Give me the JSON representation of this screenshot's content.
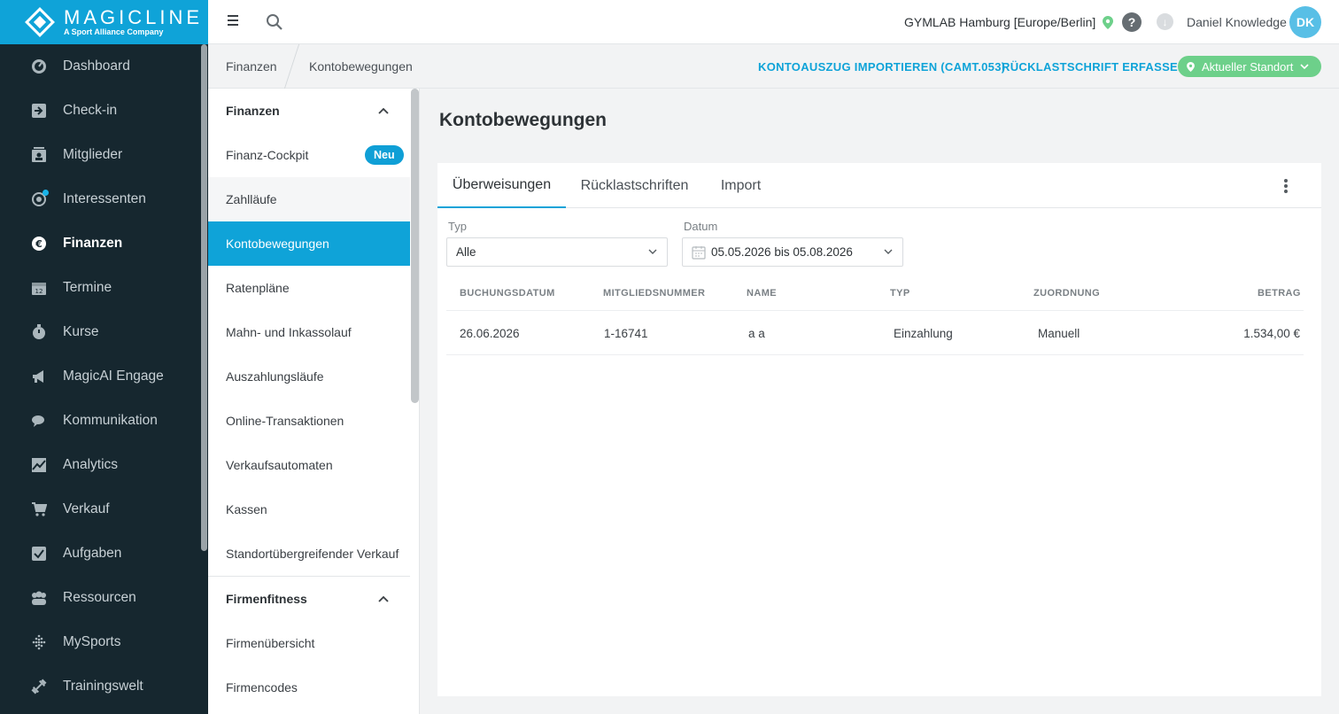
{
  "brand": {
    "name": "MAGICLINE",
    "tagline": "A Sport Alliance Company"
  },
  "left_nav": {
    "items": [
      {
        "label": "Dashboard",
        "icon": "dashboard-icon"
      },
      {
        "label": "Check-in",
        "icon": "checkin-icon"
      },
      {
        "label": "Mitglieder",
        "icon": "members-icon"
      },
      {
        "label": "Interessenten",
        "icon": "prospects-icon"
      },
      {
        "label": "Finanzen",
        "icon": "euro-icon"
      },
      {
        "label": "Termine",
        "icon": "calendar-icon"
      },
      {
        "label": "Kurse",
        "icon": "timer-icon"
      },
      {
        "label": "MagicAI Engage",
        "icon": "megaphone-icon"
      },
      {
        "label": "Kommunikation",
        "icon": "chat-icon"
      },
      {
        "label": "Analytics",
        "icon": "chart-icon"
      },
      {
        "label": "Verkauf",
        "icon": "cart-icon"
      },
      {
        "label": "Aufgaben",
        "icon": "checkbox-icon"
      },
      {
        "label": "Ressourcen",
        "icon": "people-icon"
      },
      {
        "label": "MySports",
        "icon": "dots-grid-icon"
      },
      {
        "label": "Trainingswelt",
        "icon": "dumbbell-icon"
      }
    ],
    "active": "Finanzen"
  },
  "topbar": {
    "location": "GYMLAB Hamburg [Europe/Berlin]",
    "user_name": "Daniel Knowledge",
    "avatar_initials": "DK"
  },
  "breadcrumb": {
    "parent": "Finanzen",
    "current": "Kontobewegungen"
  },
  "actions": {
    "import_label": "KONTOAUSZUG IMPORTIEREN (CAMT.053)",
    "chargeback_label": "RÜCKLASTSCHRIFT ERFASSEN",
    "location_button": "Aktueller Standort"
  },
  "sub_nav": {
    "group1": "Finanzen",
    "items": [
      {
        "label": "Finanz-Cockpit"
      },
      {
        "label": "Zahlläufe"
      },
      {
        "label": "Kontobewegungen"
      },
      {
        "label": "Ratenpläne"
      },
      {
        "label": "Mahn- und Inkassolauf"
      },
      {
        "label": "Auszahlungsläufe"
      },
      {
        "label": "Online-Transaktionen"
      },
      {
        "label": "Verkaufsautomaten"
      },
      {
        "label": "Kassen"
      },
      {
        "label": "Standortübergreifender Verkauf"
      }
    ],
    "badge_new": "Neu",
    "group2": "Firmenfitness",
    "items2": [
      {
        "label": "Firmenübersicht"
      },
      {
        "label": "Firmencodes"
      }
    ]
  },
  "main": {
    "title": "Kontobewegungen",
    "tabs": [
      {
        "label": "Überweisungen"
      },
      {
        "label": "Rücklastschriften"
      },
      {
        "label": "Import"
      }
    ],
    "filters": {
      "type_label": "Typ",
      "type_value": "Alle",
      "date_label": "Datum",
      "date_value": "05.05.2026 bis 05.08.2026"
    },
    "table": {
      "headers": [
        "BUCHUNGSDATUM",
        "MITGLIEDSNUMMER",
        "NAME",
        "TYP",
        "ZUORDNUNG",
        "BETRAG"
      ],
      "rows": [
        [
          "26.06.2026",
          "1-16741",
          "a a",
          "Einzahlung",
          "Manuell",
          "1.534,00 €"
        ]
      ]
    }
  },
  "colors": {
    "brand_blue": "#0fa3d8",
    "nav_dark": "#16272f",
    "location_green": "#6dd08a"
  }
}
